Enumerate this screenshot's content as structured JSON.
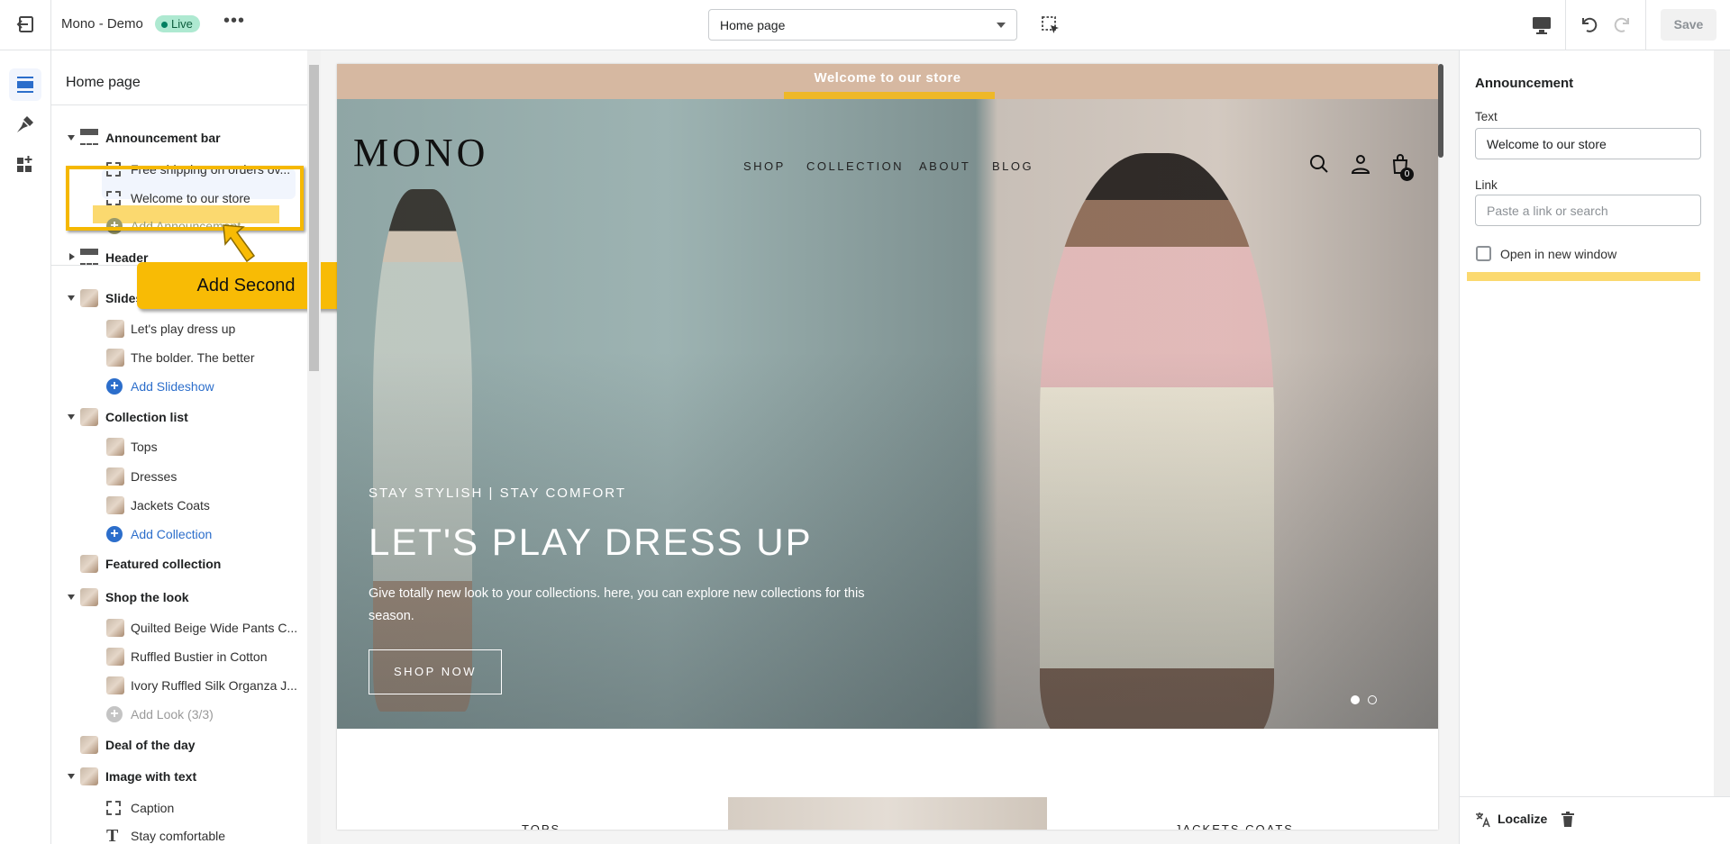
{
  "topbar": {
    "store_name": "Mono - Demo",
    "status": "Live",
    "more": "•••",
    "page_select": "Home page",
    "save": "Save"
  },
  "left_panel": {
    "title": "Home page",
    "rows": [
      {
        "type": "sec",
        "label": "Announcement bar",
        "icon": "section-icon",
        "expanded": true
      },
      {
        "type": "child",
        "label": "Free shipping on orders ov...",
        "icon": "block-icon"
      },
      {
        "type": "child",
        "label": "Welcome to our store",
        "icon": "block-icon",
        "selected": true
      },
      {
        "type": "add",
        "label": "Add Announcement",
        "icon": "plus-icon"
      },
      {
        "type": "sec",
        "label": "Header",
        "icon": "section-icon",
        "expanded": false
      },
      {
        "type": "sec",
        "label": "Slideshow",
        "icon": "thumb",
        "expanded": true
      },
      {
        "type": "child",
        "label": "Let's play dress up",
        "icon": "thumb"
      },
      {
        "type": "child",
        "label": "The bolder. The better",
        "icon": "thumb"
      },
      {
        "type": "add",
        "label": "Add Slideshow",
        "icon": "plus-icon"
      },
      {
        "type": "sec",
        "label": "Collection list",
        "icon": "thumb",
        "expanded": true
      },
      {
        "type": "child",
        "label": "Tops",
        "icon": "thumb"
      },
      {
        "type": "child",
        "label": "Dresses",
        "icon": "thumb"
      },
      {
        "type": "child",
        "label": "Jackets Coats",
        "icon": "thumb"
      },
      {
        "type": "add",
        "label": "Add Collection",
        "icon": "plus-icon"
      },
      {
        "type": "sec",
        "label": "Featured collection",
        "icon": "thumb"
      },
      {
        "type": "sec",
        "label": "Shop the look",
        "icon": "thumb",
        "expanded": true
      },
      {
        "type": "child",
        "label": "Quilted Beige Wide Pants C...",
        "icon": "thumb"
      },
      {
        "type": "child",
        "label": "Ruffled Bustier in Cotton",
        "icon": "thumb"
      },
      {
        "type": "child",
        "label": "Ivory Ruffled Silk Organza J...",
        "icon": "thumb"
      },
      {
        "type": "dis",
        "label": "Add Look (3/3)",
        "icon": "plus-icon"
      },
      {
        "type": "sec",
        "label": "Deal of the day",
        "icon": "thumb"
      },
      {
        "type": "sec",
        "label": "Image with text",
        "icon": "thumb",
        "expanded": true
      },
      {
        "type": "child",
        "label": "Caption",
        "icon": "block-icon"
      },
      {
        "type": "child",
        "label": "Stay comfortable",
        "icon": "text-icon"
      }
    ]
  },
  "callout": {
    "label": "Add Second",
    "color": "#f8bb05"
  },
  "preview": {
    "announcement": "Welcome to our store",
    "logo": "MONO",
    "nav": [
      "SHOP",
      "COLLECTION",
      "ABOUT",
      "BLOG"
    ],
    "cart_count": "0",
    "hero": {
      "eyebrow": "STAY STYLISH | STAY COMFORT",
      "title": "LET'S PLAY DRESS UP",
      "text": "Give totally new look to your collections. here, you can explore new collections for this season.",
      "button": "SHOP NOW",
      "slides": 2,
      "active_slide": 1
    },
    "collections": [
      "TOPS",
      "JACKETS COATS"
    ]
  },
  "right_panel": {
    "title": "Announcement",
    "text_label": "Text",
    "text_value": "Welcome to our store",
    "link_label": "Link",
    "link_placeholder": "Paste a link or search",
    "checkbox_label": "Open in new window",
    "checked": false,
    "localize": "Localize"
  }
}
